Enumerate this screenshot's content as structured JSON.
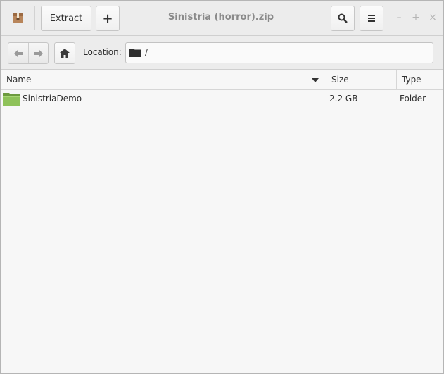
{
  "window": {
    "title": "Sinistria (horror).zip"
  },
  "toolbar": {
    "extract_label": "Extract",
    "add_label": "+",
    "search_icon": "search-icon",
    "menu_icon": "hamburger-menu-icon",
    "minimize_label": "–",
    "maximize_label": "+",
    "close_label": "×"
  },
  "location": {
    "label": "Location:",
    "path": "/"
  },
  "columns": {
    "name": "Name",
    "size": "Size",
    "type": "Type"
  },
  "files": [
    {
      "name": "SinistriaDemo",
      "size": "2.2 GB",
      "type": "Folder",
      "icon": "folder-icon"
    }
  ],
  "colors": {
    "folder_green": "#8fc25a",
    "title_gray": "#8a8a8a"
  }
}
